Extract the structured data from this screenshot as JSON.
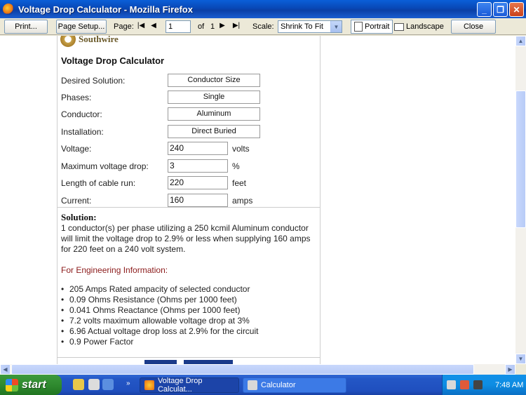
{
  "window": {
    "title": "Voltage Drop Calculator - Mozilla Firefox"
  },
  "toolbar": {
    "print_label": "Print...",
    "page_setup_label": "Page Setup...",
    "page_label": "Page:",
    "page_value": "1",
    "of_label": "of",
    "total_pages": "1",
    "scale_label": "Scale:",
    "scale_value": "Shrink To Fit",
    "portrait_label": "Portrait",
    "landscape_label": "Landscape",
    "close_label": "Close"
  },
  "page": {
    "brand": "Southwire",
    "title": "Voltage Drop Calculator",
    "fields": [
      {
        "label": "Desired Solution:",
        "value": "Conductor Size"
      },
      {
        "label": "Phases:",
        "value": "Single"
      },
      {
        "label": "Conductor:",
        "value": "Aluminum"
      },
      {
        "label": "Installation:",
        "value": "Direct Buried"
      },
      {
        "label": "Voltage:",
        "value": "240",
        "unit": "volts"
      },
      {
        "label": "Maximum voltage drop:",
        "value": "3",
        "unit": "%"
      },
      {
        "label": "Length of cable run:",
        "value": "220",
        "unit": "feet"
      },
      {
        "label": "Current:",
        "value": "160",
        "unit": "amps"
      }
    ],
    "solution_heading": "Solution:",
    "solution_text": "1 conductor(s) per phase utilizing a 250 kcmil Aluminum conductor will limit the voltage drop to 2.9% or less when supplying 160 amps for 220 feet on a 240 volt system.",
    "engineering_heading": "For Engineering Information:",
    "engineering_items": [
      "205 Amps Rated ampacity of selected conductor",
      "0.09 Ohms Resistance (Ohms per 1000 feet)",
      "0.041 Ohms Reactance (Ohms per 1000 feet)",
      "7.2 volts maximum allowable voltage drop at 3%",
      "6.96 Actual voltage drop loss at 2.9% for the circuit",
      "0.9 Power Factor"
    ]
  },
  "taskbar": {
    "start_label": "start",
    "tasks": [
      "Voltage Drop Calculat...",
      "Calculator"
    ],
    "clock": "7:48 AM"
  }
}
